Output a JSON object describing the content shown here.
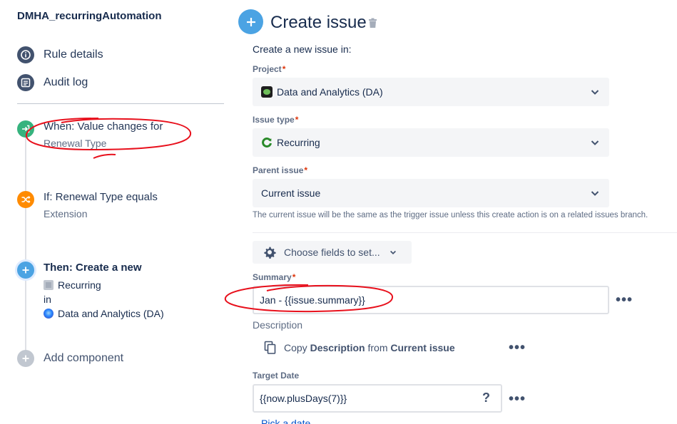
{
  "rule_name": "DMHA_recurringAutomation",
  "nav": {
    "rule_details": "Rule details",
    "audit_log": "Audit log"
  },
  "flow": {
    "trigger": {
      "title": "When: Value changes for",
      "subtitle": "Renewal Type"
    },
    "condition": {
      "title": "If: Renewal Type equals",
      "subtitle": "Extension"
    },
    "action": {
      "title": "Then: Create a new",
      "issue_type": "Recurring",
      "connector": "in",
      "project": "Data and Analytics (DA)"
    },
    "add_component": "Add component"
  },
  "panel": {
    "title": "Create issue",
    "intro": "Create a new issue in:",
    "project": {
      "label": "Project",
      "required": "*",
      "value": "Data and Analytics (DA)"
    },
    "issue_type": {
      "label": "Issue type",
      "required": "*",
      "value": "Recurring"
    },
    "parent_issue": {
      "label": "Parent issue",
      "required": "*",
      "value": "Current issue",
      "helper": "The current issue will be the same as the trigger issue unless this create action is on a related issues branch."
    },
    "choose_fields": "Choose fields to set...",
    "summary": {
      "label": "Summary",
      "required": "*",
      "value": "Jan - {{issue.summary}}"
    },
    "description": {
      "label": "Description",
      "copy_prefix": "Copy",
      "copy_field": "Description",
      "copy_middle": "from",
      "copy_source": "Current issue"
    },
    "target_date": {
      "label": "Target Date",
      "value": "{{now.plusDays(7)}}",
      "help": "?",
      "pick": "Pick a date"
    },
    "more": "•••"
  },
  "colors": {
    "accent_blue": "#4ba3e3",
    "trigger_green": "#36b37e",
    "condition_orange": "#ff8b00",
    "annotation_red": "#e8101c"
  }
}
